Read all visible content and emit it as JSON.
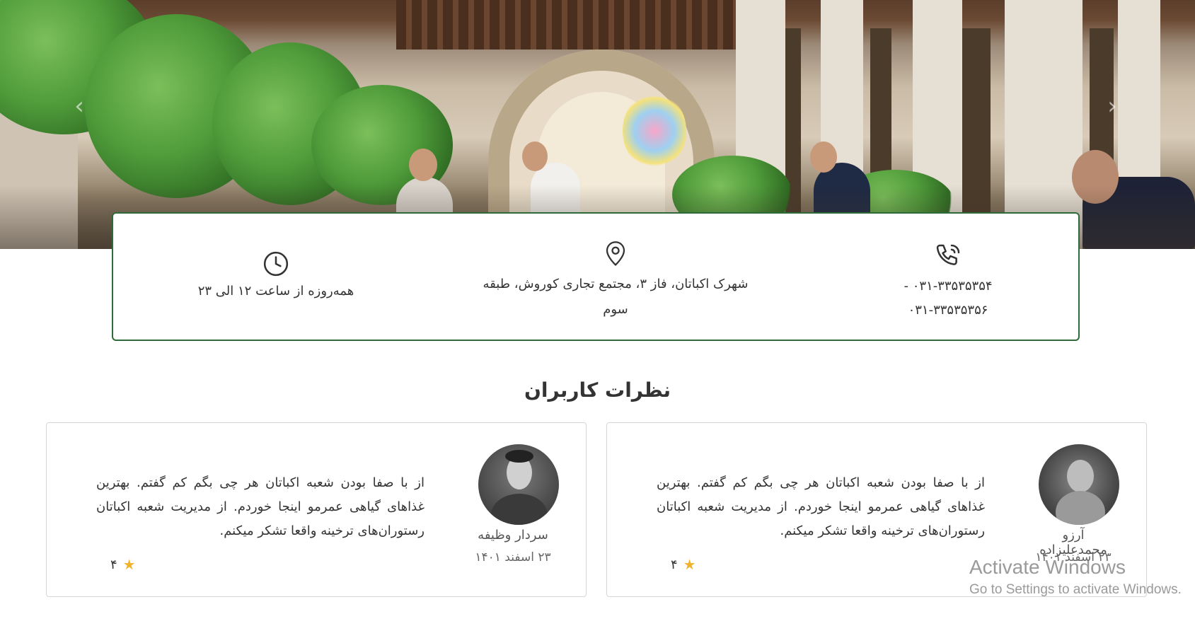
{
  "info": {
    "phone_line1": "۰۳۱-۳۳۵۳۵۳۵۴ -",
    "phone_line2": "۰۳۱-۳۳۵۳۵۳۵۶",
    "address_line1": "شهرک اکباتان، فاز ۳، مجتمع تجاری کوروش، طبقه",
    "address_line2": "سوم",
    "hours": "همه‌روزه از ساعت ۱۲ الی ۲۳",
    "icons": [
      "phone-icon",
      "location-pin-icon",
      "clock-icon"
    ]
  },
  "reviews_section": {
    "title": "نظرات کاربران",
    "reviews": [
      {
        "name": "آرزو محمدعلیزاده",
        "date": "۲۳ اسفند ۱۴۰۱",
        "text": "از با صفا بودن شعبه اکباتان هر چی بگم کم گفتم. بهترین غذاهای گیاهی عمرمو اینجا خوردم. از مدیریت شعبه اکباتان رستوران‌های ترخینه واقعا تشکر میکنم.",
        "rating": "۴"
      },
      {
        "name": "سردار وظیفه",
        "date": "۲۳ اسفند ۱۴۰۱",
        "text": "از با صفا بودن شعبه اکباتان هر چی بگم کم گفتم. بهترین غذاهای گیاهی عمرمو اینجا خوردم. از مدیریت شعبه اکباتان رستوران‌های ترخینه واقعا تشکر میکنم.",
        "rating": "۴"
      }
    ]
  },
  "carousel": {
    "prev_icon": "chevron-left-icon",
    "next_icon": "chevron-right-icon"
  },
  "watermark": {
    "line1": "Activate Windows",
    "line2": "Go to Settings to activate Windows."
  },
  "colors": {
    "accent_green": "#2f6b3a",
    "star": "#f0b429"
  }
}
